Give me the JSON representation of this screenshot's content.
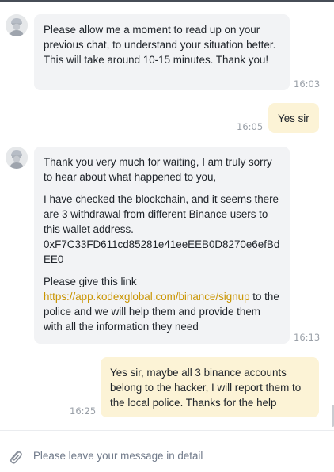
{
  "chat": {
    "messages": [
      {
        "sender": "agent",
        "paragraphs": [
          "Please allow me a moment to read up on your previous chat, to understand your situation better. This will take around 10-15 minutes. Thank you!"
        ],
        "time": "16:03"
      },
      {
        "sender": "user",
        "text": "Yes sir",
        "time": "16:05"
      },
      {
        "sender": "agent",
        "paragraphs": [
          "Thank you very much for waiting, I am truly sorry to hear about what happened to you,",
          "I have checked the blockchain, and it seems there are 3 withdrawal from different Binance users to this wallet address.",
          "0xF7C33FD611cd85281e41eeEEB0D8270e6efBdEE0"
        ],
        "link_para": {
          "before": "Please give this link ",
          "link": "https://app.kodexglobal.com/binance/signup",
          "after": " to the police and we will help them and provide them with all the information they need"
        },
        "time": "16:13"
      },
      {
        "sender": "user",
        "text": "Yes sir, maybe all 3 binance accounts belong to the hacker, I will report them to the local police. Thanks for the help",
        "time": "16:25"
      }
    ]
  },
  "composer": {
    "placeholder": "Please leave your message in detail",
    "attach_icon": "paperclip-icon"
  },
  "colors": {
    "agent_bubble": "#f2f3f5",
    "user_bubble": "#fcf3d6",
    "link": "#c99400",
    "timestamp": "#9aa0a8"
  }
}
